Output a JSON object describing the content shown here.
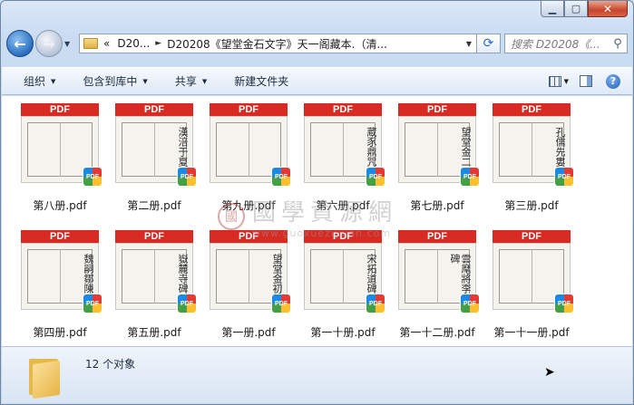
{
  "address": {
    "chevron": "«",
    "crumb1": "D20...",
    "crumb2": "D20208《望堂金石文字》天一阁藏本.（清..."
  },
  "search": {
    "placeholder": "搜索 D20208《..."
  },
  "toolbar": {
    "organize": "组织",
    "include_library": "包含到库中",
    "share": "共享",
    "new_folder": "新建文件夹"
  },
  "thumb_label": "PDF",
  "files": [
    {
      "name": "第八册.pdf",
      "glyphs": ""
    },
    {
      "name": "第二册.pdf",
      "glyphs": "漢涪于夏承碑"
    },
    {
      "name": "第九册.pdf",
      "glyphs": ""
    },
    {
      "name": "第六册.pdf",
      "glyphs": "蔵豕鼎咒鏊婢"
    },
    {
      "name": "第七册.pdf",
      "glyphs": "望堂金二集"
    },
    {
      "name": "第三册.pdf",
      "glyphs": "孔儒先婁壽碑"
    },
    {
      "name": "第四册.pdf",
      "glyphs": "魏嗣鄒陳"
    },
    {
      "name": "第五册.pdf",
      "glyphs": "嶽麓寺碑"
    },
    {
      "name": "第一册.pdf",
      "glyphs": "望堂金初集"
    },
    {
      "name": "第一十册.pdf",
      "glyphs": "宋拓道碑師"
    },
    {
      "name": "第一十二册.pdf",
      "glyphs": "雲麾將李思訓碑"
    },
    {
      "name": "第一十一册.pdf",
      "glyphs": ""
    }
  ],
  "watermark": {
    "cn": "國學資源網",
    "url": "www.guoxueziyuan.com",
    "logo": "國"
  },
  "status": {
    "count": "12 个对象"
  }
}
